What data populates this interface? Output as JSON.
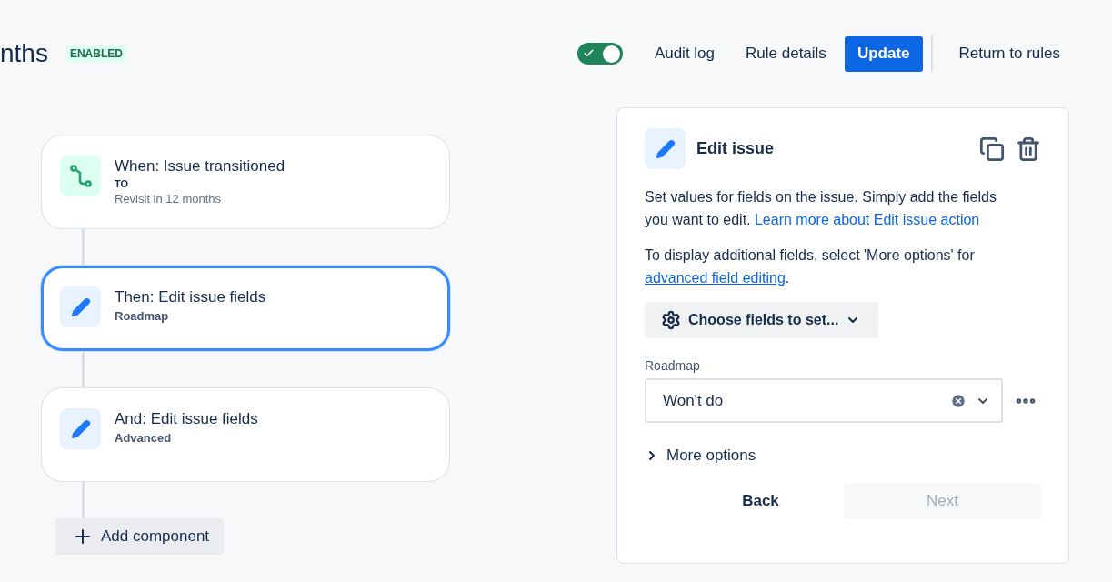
{
  "header": {
    "title": "nths",
    "status": "ENABLED",
    "toggle": {
      "on": true
    },
    "actions": [
      {
        "label": "Audit log",
        "kind": "subtle"
      },
      {
        "label": "Rule details",
        "kind": "subtle"
      },
      {
        "label": "Update",
        "kind": "primary"
      },
      {
        "label": "Return to rules",
        "kind": "subtle"
      }
    ]
  },
  "flow": {
    "cards": [
      {
        "kind": "trigger",
        "title": "When: Issue transitioned",
        "lines": [
          {
            "text": "TO",
            "kind": "tag"
          },
          {
            "text": "Revisit in 12 months",
            "kind": "muted"
          }
        ],
        "selected": false
      },
      {
        "kind": "action",
        "title": "Then: Edit issue fields",
        "lines": [
          {
            "text": "Roadmap",
            "kind": "bold"
          }
        ],
        "selected": true
      },
      {
        "kind": "action",
        "title": "And: Edit issue fields",
        "lines": [
          {
            "text": "Advanced",
            "kind": "bold"
          }
        ],
        "selected": false
      }
    ],
    "add_button": "Add component"
  },
  "panel": {
    "title": "Edit issue",
    "description": "Set values for fields on the issue. Simply add the fields you want to edit.",
    "description_link": "Learn more about Edit issue action",
    "note": "To display additional fields, select 'More options' for",
    "note_link": "advanced field editing",
    "note_end": ".",
    "choose_button": "Choose fields to set...",
    "field": {
      "label": "Roadmap",
      "value": "Won't do"
    },
    "more_options": {
      "label": "More options",
      "expanded": false
    },
    "buttons": [
      {
        "label": "Back",
        "disabled": false,
        "kind": "subtle"
      },
      {
        "label": "Next",
        "disabled": true,
        "kind": "primary"
      }
    ]
  }
}
